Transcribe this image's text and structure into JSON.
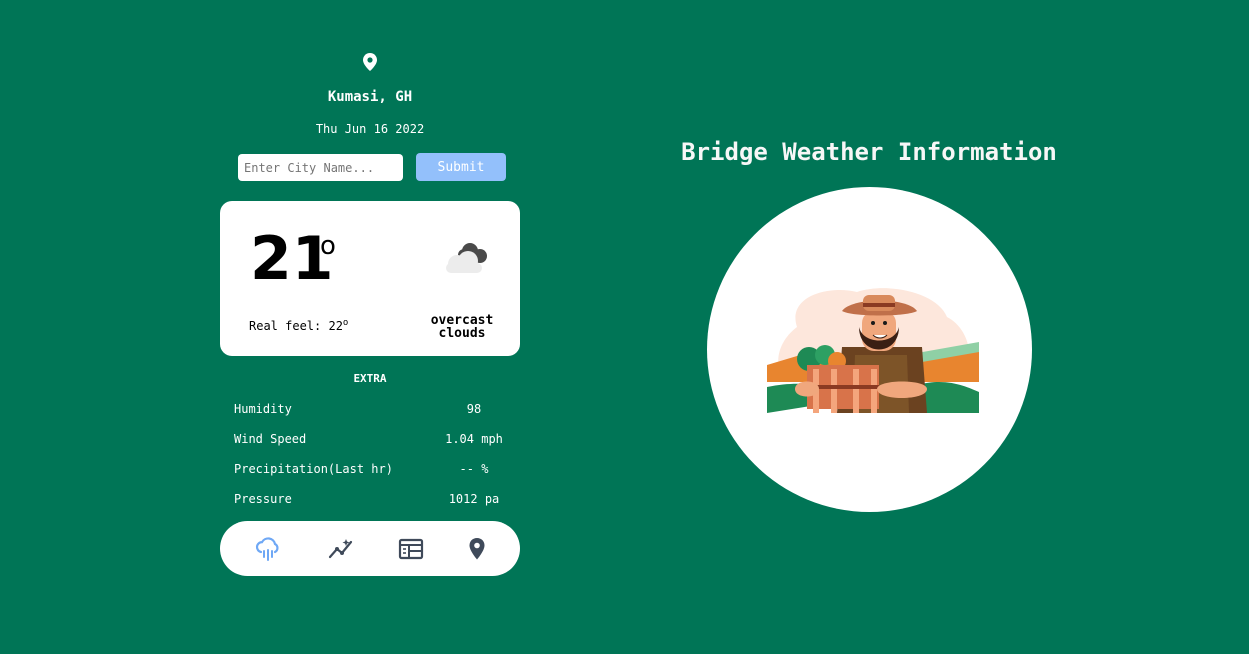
{
  "location": {
    "city": "Kumasi, GH",
    "date": "Thu Jun 16 2022"
  },
  "search": {
    "placeholder": "Enter City Name...",
    "submit_label": "Submit"
  },
  "current": {
    "temperature": "21",
    "degree_symbol": "o",
    "real_feel_label": "Real feel: 22",
    "real_feel_degree": "o",
    "description_line1": "overcast",
    "description_line2": "clouds",
    "icon": "cloud-icon"
  },
  "extra": {
    "title": "EXTRA",
    "rows": [
      {
        "label": "Humidity",
        "value": "98"
      },
      {
        "label": "Wind Speed",
        "value": "1.04 mph"
      },
      {
        "label": "Precipitation(Last hr)",
        "value": "-- %"
      },
      {
        "label": "Pressure",
        "value": "1012 pa"
      }
    ]
  },
  "nav": {
    "items": [
      {
        "icon": "rain-cloud-icon",
        "active": true
      },
      {
        "icon": "trend-chart-icon",
        "active": false
      },
      {
        "icon": "calendar-grid-icon",
        "active": false
      },
      {
        "icon": "location-pin-icon",
        "active": false
      }
    ]
  },
  "hero": {
    "title": "Bridge Weather Information",
    "illustration": "farmer-illustration"
  },
  "colors": {
    "background": "#007556",
    "submit": "#93c0fb",
    "active_nav": "#6fa8f5",
    "nav_icon": "#3f4a5a"
  }
}
